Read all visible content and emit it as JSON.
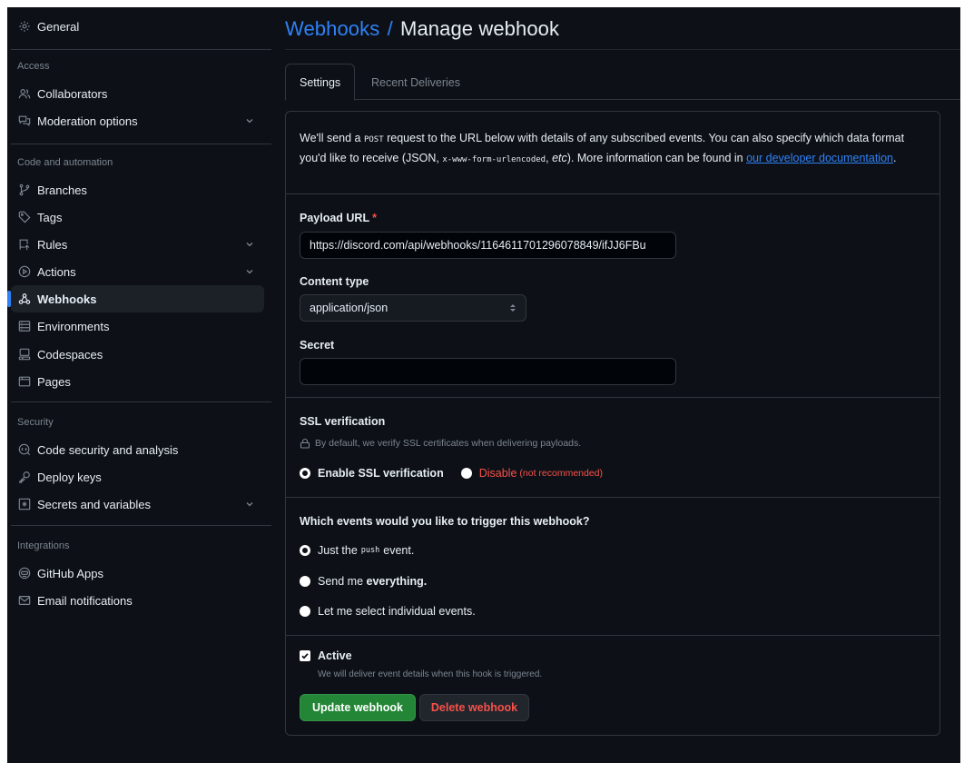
{
  "sidebar": {
    "general": "General",
    "access_head": "Access",
    "collaborators": "Collaborators",
    "moderation": "Moderation options",
    "code_head": "Code and automation",
    "branches": "Branches",
    "tags": "Tags",
    "rules": "Rules",
    "actions": "Actions",
    "webhooks": "Webhooks",
    "environments": "Environments",
    "codespaces": "Codespaces",
    "pages": "Pages",
    "security_head": "Security",
    "code_security": "Code security and analysis",
    "deploy_keys": "Deploy keys",
    "secrets": "Secrets and variables",
    "integrations_head": "Integrations",
    "github_apps": "GitHub Apps",
    "email_notifications": "Email notifications"
  },
  "header": {
    "crumb": "Webhooks",
    "separator": "/",
    "title": "Manage webhook"
  },
  "tabs": {
    "settings": "Settings",
    "recent_deliveries": "Recent Deliveries"
  },
  "intro": {
    "part1": "We'll send a ",
    "method": "POST",
    "part2": " request to the URL below with details of any subscribed events. You can also specify which data format you'd like to receive (JSON, ",
    "encoding": "x-www-form-urlencoded",
    "part3": ", ",
    "etc": "etc",
    "part4": "). More information can be found in ",
    "link": "our developer documentation",
    "part5": "."
  },
  "form": {
    "payload_label": "Payload URL",
    "required_mark": "*",
    "payload_value": "https://discord.com/api/webhooks/1164611701296078849/ifJJ6FBu",
    "content_type_label": "Content type",
    "content_type_value": "application/json",
    "secret_label": "Secret",
    "secret_value": ""
  },
  "ssl": {
    "label": "SSL verification",
    "help": "By default, we verify SSL certificates when delivering payloads.",
    "enable": "Enable SSL verification",
    "disable": "Disable",
    "not_recommended": "(not recommended)",
    "selected": "enable"
  },
  "events": {
    "question": "Which events would you like to trigger this webhook?",
    "push_prefix": "Just the",
    "push_code": "push",
    "push_suffix": "event.",
    "everything_prefix": "Send me",
    "everything_bold": "everything.",
    "individual": "Let me select individual events.",
    "selected": "push"
  },
  "active": {
    "label": "Active",
    "checked": true,
    "help": "We will deliver event details when this hook is triggered."
  },
  "buttons": {
    "update": "Update webhook",
    "delete": "Delete webhook"
  },
  "colors": {
    "background": "#0d1117",
    "accent": "#2f81f7",
    "danger": "#f85149",
    "primary_button": "#238636",
    "border": "#30363d",
    "muted": "#7d8590"
  }
}
